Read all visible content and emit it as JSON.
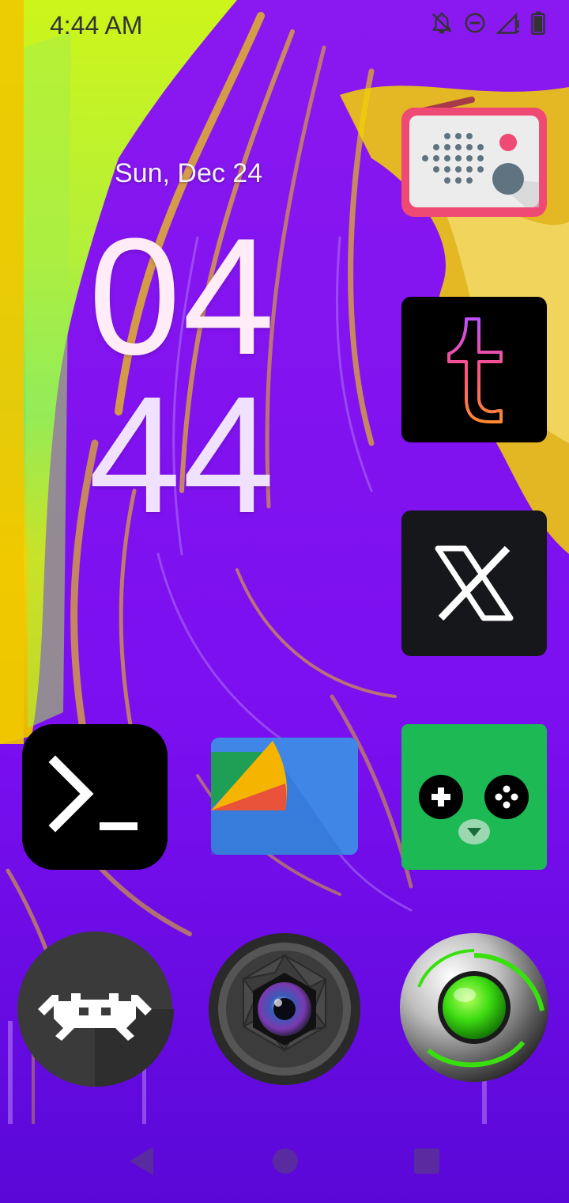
{
  "status_bar": {
    "time": "4:44 AM",
    "icons": [
      "notifications-off-icon",
      "do-not-disturb-icon",
      "cellular-signal-icon",
      "battery-icon"
    ]
  },
  "clock_widget": {
    "date": "Sun, Dec 24",
    "hour": "04",
    "minute": "44"
  },
  "apps": [
    {
      "name": "radio-app",
      "icon": "radio-icon"
    },
    {
      "name": "tumblr-app",
      "icon": "tumblr-icon"
    },
    {
      "name": "x-app",
      "icon": "x-logo-icon"
    },
    {
      "name": "terminal-app",
      "icon": "terminal-icon"
    },
    {
      "name": "files-app",
      "icon": "files-icon"
    },
    {
      "name": "game-app",
      "icon": "gamepad-icon"
    }
  ],
  "dock": [
    {
      "name": "retroarch-app",
      "icon": "space-invader-icon"
    },
    {
      "name": "camera-app",
      "icon": "camera-lens-icon"
    },
    {
      "name": "browser-app",
      "icon": "green-orb-icon"
    }
  ],
  "nav_bar": {
    "buttons": [
      "back-icon",
      "home-icon",
      "recents-icon"
    ]
  },
  "colors": {
    "wallpaper_purple": "#7a10e8",
    "wallpaper_yellow": "#f5d400",
    "wallpaper_green": "#b6f02a"
  }
}
